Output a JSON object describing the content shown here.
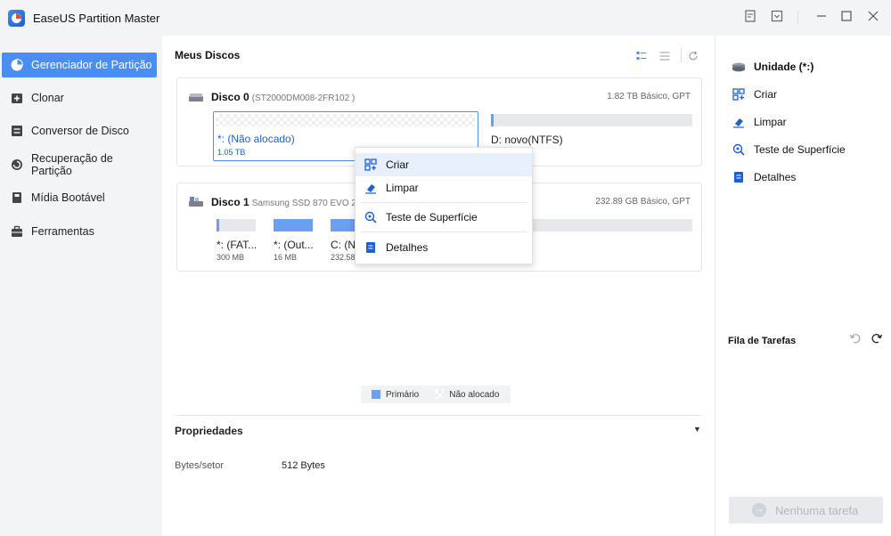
{
  "app": {
    "title": "EaseUS Partition Master"
  },
  "colors": {
    "accent": "#4a8ef2",
    "primary_partition": "#6b9ff0",
    "selected_border": "#4a8ef2"
  },
  "sidebar": {
    "items": [
      {
        "label": "Gerenciador de Partição",
        "icon": "pie-chart-icon",
        "active": true
      },
      {
        "label": "Clonar",
        "icon": "clone-icon"
      },
      {
        "label": "Conversor de Disco",
        "icon": "disk-convert-icon"
      },
      {
        "label": "Recuperação de Partição",
        "icon": "recovery-icon"
      },
      {
        "label": "Mídia Bootável",
        "icon": "bootable-media-icon"
      },
      {
        "label": "Ferramentas",
        "icon": "toolbox-icon"
      }
    ]
  },
  "main": {
    "title": "Meus Discos",
    "disks": [
      {
        "name": "Disco 0",
        "model": "(ST2000DM008-2FR102 )",
        "info": "1.82 TB Básico, GPT",
        "partitions": [
          {
            "label": "*: (Não alocado)",
            "size": "1.05 TB",
            "type": "unallocated",
            "selected": true
          },
          {
            "label": "D: novo(NTFS)",
            "size": "",
            "type": "unallocated"
          }
        ]
      },
      {
        "name": "Disco 1",
        "model": "Samsung SSD 870 EVO 2500",
        "info": "232.89 GB Básico, GPT",
        "partitions": [
          {
            "label": "*: (FAT...",
            "size": "300 MB",
            "type": "primary"
          },
          {
            "label": "*: (Out...",
            "size": "16 MB",
            "type": "primary"
          },
          {
            "label": "C: (N",
            "size": "232.58",
            "type": "primary"
          }
        ]
      }
    ],
    "legend": {
      "primary": "Primário",
      "unallocated": "Não alocado"
    },
    "properties": {
      "title": "Propriedades",
      "rows": [
        {
          "key": "Bytes/setor",
          "value": "512 Bytes"
        }
      ]
    }
  },
  "context_menu": {
    "items": [
      {
        "label": "Criar",
        "icon": "create-partition-icon",
        "hover": true
      },
      {
        "label": "Limpar",
        "icon": "eraser-icon"
      },
      {
        "label": "Teste de Superfície",
        "icon": "surface-test-icon"
      },
      {
        "label": "Detalhes",
        "icon": "details-icon"
      }
    ]
  },
  "right_panel": {
    "header": "Unidade (*:)",
    "actions": [
      {
        "label": "Criar",
        "icon": "create-partition-icon"
      },
      {
        "label": "Limpar",
        "icon": "eraser-icon"
      },
      {
        "label": "Teste de Superfície",
        "icon": "surface-test-icon"
      },
      {
        "label": "Detalhes",
        "icon": "details-icon"
      }
    ],
    "queue_title": "Fila de Tarefas",
    "no_task_label": "Nenhuma tarefa"
  }
}
